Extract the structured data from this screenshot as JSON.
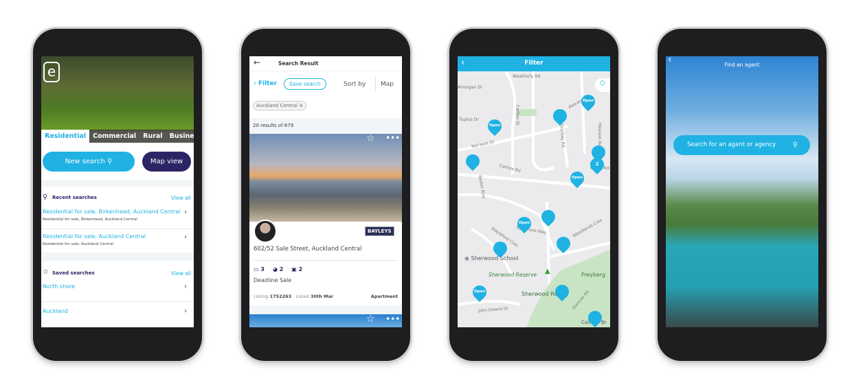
{
  "colors": {
    "accent": "#1fb2e3",
    "navy": "#2b2566"
  },
  "screen1": {
    "logo": "e",
    "tabs": [
      "Residential",
      "Commercial",
      "Rural",
      "Business"
    ],
    "new_search": "New search",
    "map_view": "Map view",
    "recent_title": "Recent searches",
    "view_all": "View all",
    "recent": [
      {
        "title": "Residential for sale, Birkenhead, Auckland Central",
        "sub": "Residential for sale, Birkenhead, Auckland Central"
      },
      {
        "title": "Residential for sale, Auckland Central",
        "sub": "Residential for sale, Auckland Central"
      }
    ],
    "saved_title": "Saved searches",
    "saved": [
      "North shore",
      "Auckland"
    ]
  },
  "screen2": {
    "title": "Search Result",
    "filter": "Filter",
    "save_search": "Save search",
    "sort_by": "Sort by",
    "map": "Map",
    "chip": "Auckland Central",
    "results": "20 results of 679",
    "agency": "BAYLEYS",
    "address": "602/52 Sale Street, Auckland Central",
    "beds": "3",
    "baths": "2",
    "cars": "2",
    "sale_type": "Deadline Sale",
    "listing_label": "Listing",
    "listing_no": "1752263",
    "listed_label": "Listed",
    "listed_date": "30th Mar",
    "type": "Apartment"
  },
  "screen3": {
    "title": "Filter",
    "streets": [
      "Weatherly Rd",
      "Amorgan Dr",
      "Topliss Dr",
      "Carlton St",
      "Finchley Rd",
      "Alexander",
      "Mawson Ave",
      "Nor'east Dr",
      "Carlisle Rd",
      "Barker Rise",
      "Fisher Rd",
      "Stapleford Cres",
      "Sycamore Way",
      "Woodlands Cres",
      "Sherwood School",
      "Sherwood Reserve",
      "Freyberg",
      "Sherwood Rd",
      "Glencoe Rd",
      "John Downs Dr",
      "Caltex - Br"
    ],
    "pin_labels": [
      "Open",
      "Open",
      "Open",
      "Open",
      "Open",
      "2"
    ]
  },
  "screen4": {
    "title": "Find an agent",
    "search_placeholder": "Search for an agent or agency"
  }
}
